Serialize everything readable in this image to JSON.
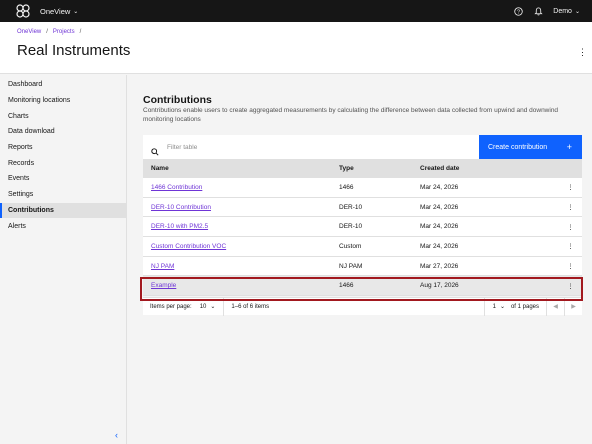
{
  "topbar": {
    "app_name": "OneView",
    "user_name": "Demo"
  },
  "breadcrumb": {
    "items": [
      "OneView",
      "Projects"
    ],
    "separator": "/"
  },
  "header": {
    "title": "Real Instruments"
  },
  "sidebar": {
    "items": [
      {
        "label": "Dashboard"
      },
      {
        "label": "Monitoring locations"
      },
      {
        "label": "Charts"
      },
      {
        "label": "Data download"
      },
      {
        "label": "Reports"
      },
      {
        "label": "Records"
      },
      {
        "label": "Events"
      },
      {
        "label": "Settings"
      },
      {
        "label": "Contributions"
      },
      {
        "label": "Alerts"
      }
    ],
    "active": "Contributions"
  },
  "contributions": {
    "title": "Contributions",
    "description": "Contributions enable users to create aggregated measurements by calculating the difference between data collected from upwind and downwind monitoring locations",
    "filter_placeholder": "Filter table",
    "create_label": "Create contribution",
    "columns": [
      "Name",
      "Type",
      "Created date"
    ],
    "rows": [
      {
        "name": "1466 Contribution",
        "type": "1466",
        "date": "Mar 24, 2026"
      },
      {
        "name": "DER-10 Contribution",
        "type": "DER-10",
        "date": "Mar 24, 2026"
      },
      {
        "name": "DER-10 with PM2.5",
        "type": "DER-10",
        "date": "Mar 24, 2026"
      },
      {
        "name": "Custom Contribution VOC",
        "type": "Custom",
        "date": "Mar 24, 2026"
      },
      {
        "name": "NJ PAM",
        "type": "NJ PAM",
        "date": "Mar 27, 2026"
      },
      {
        "name": "Example",
        "type": "1466",
        "date": "Aug 17, 2026"
      }
    ]
  },
  "pagination": {
    "items_per_page_label": "Items per page:",
    "items_per_page": "10",
    "range": "1–6 of 6 items",
    "page": "1",
    "of_pages": "of 1 pages"
  },
  "colors": {
    "accent": "#0f62fe",
    "link": "#6f35d6",
    "highlight_border": "#a2191f",
    "topbar": "#161616"
  }
}
